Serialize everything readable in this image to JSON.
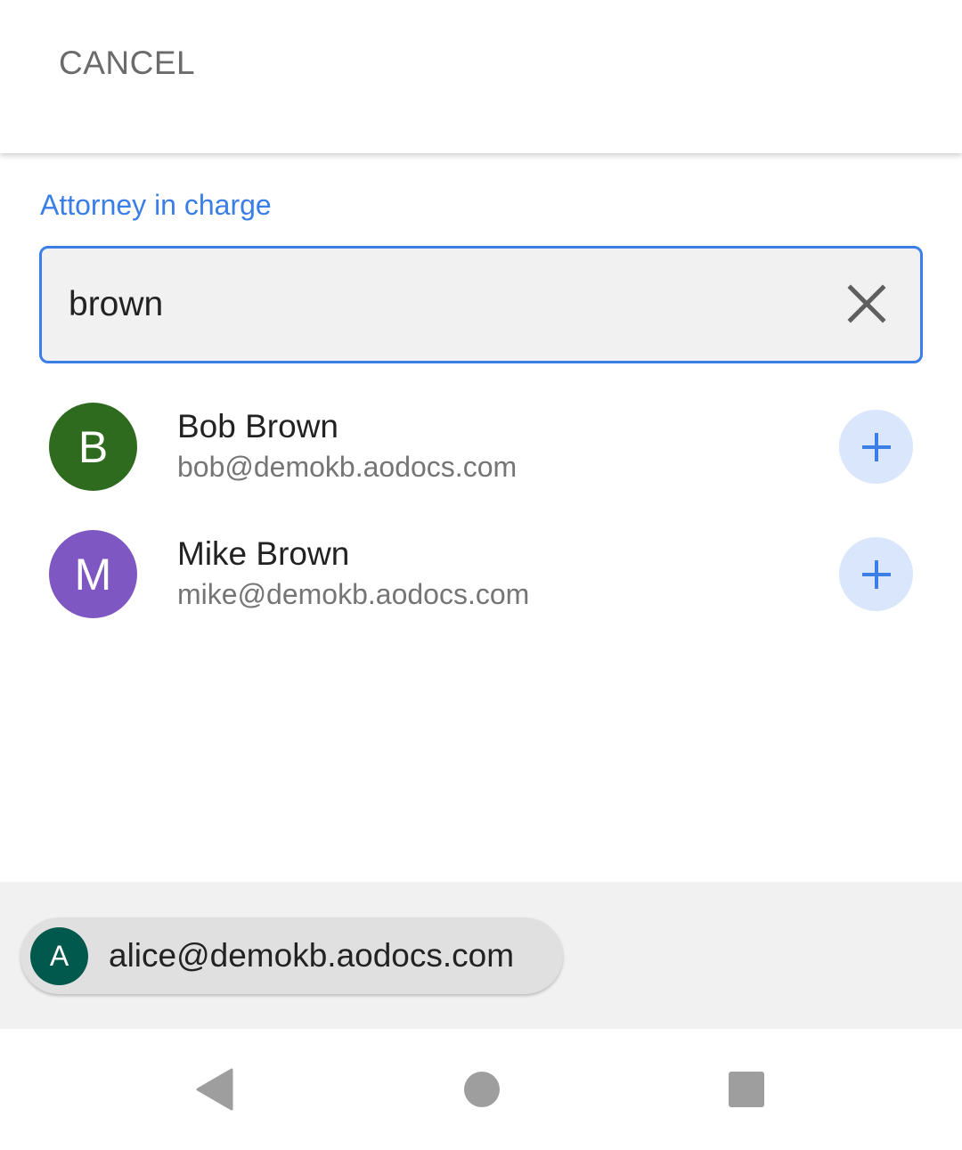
{
  "header": {
    "cancel_label": "CANCEL"
  },
  "field": {
    "label": "Attorney in charge",
    "search_value": "brown"
  },
  "results": [
    {
      "initial": "B",
      "name": "Bob Brown",
      "email": "bob@demokb.aodocs.com",
      "avatar_color": "#2f6b1f"
    },
    {
      "initial": "M",
      "name": "Mike Brown",
      "email": "mike@demokb.aodocs.com",
      "avatar_color": "#7e57c2"
    }
  ],
  "selected": [
    {
      "initial": "A",
      "email": "alice@demokb.aodocs.com",
      "avatar_color": "#00594c"
    }
  ],
  "icons": {
    "clear": "close-icon",
    "add": "plus-icon",
    "back": "nav-back-icon",
    "home": "nav-home-icon",
    "recents": "nav-recents-icon"
  },
  "colors": {
    "accent": "#3b7fe6",
    "add_button_bg": "#d9e6fb",
    "input_bg": "#f1f1f1"
  }
}
